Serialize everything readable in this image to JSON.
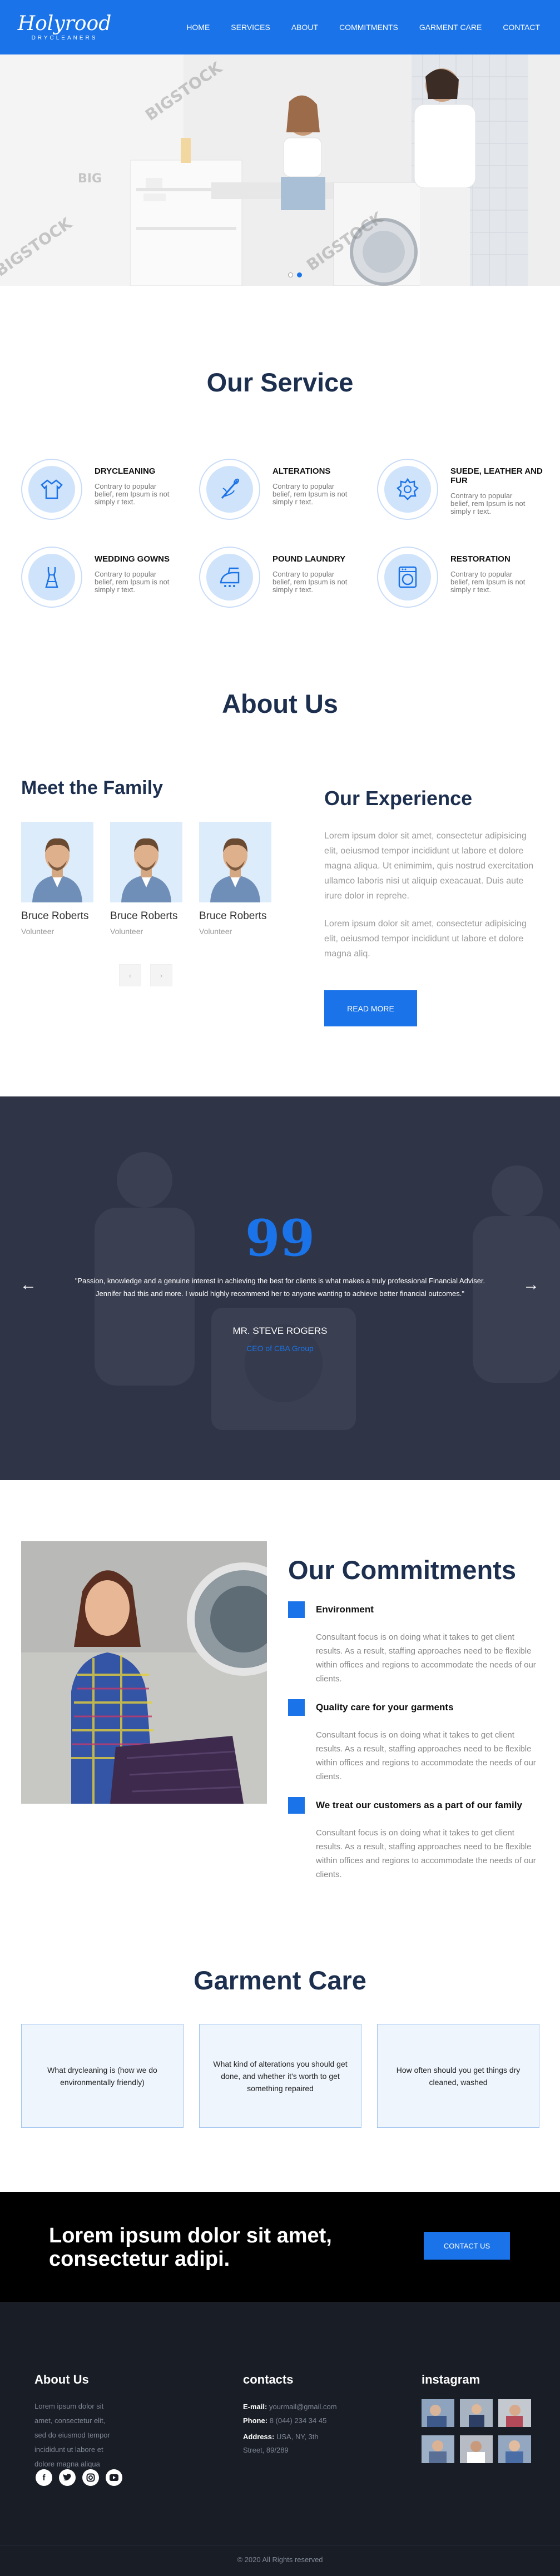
{
  "brand": {
    "logo_script": "Holyrood",
    "logo_sub": "DRYCLEANERS"
  },
  "nav": {
    "items": [
      "HOME",
      "SERVICES",
      "ABOUT",
      "COMMITMENTS",
      "GARMENT CARE",
      "CONTACT"
    ]
  },
  "hero": {
    "watermarks": [
      "BIGSTOCK",
      "BIG",
      "BIGSTOCK",
      "BIGSTOCK"
    ],
    "slide_count": 2,
    "active_slide": 1
  },
  "services": {
    "title": "Our Service",
    "items": [
      {
        "title": "DRYCLEANING",
        "desc": "Contrary to popular belief, rem Ipsum is not simply r text.",
        "icon": "shirt-icon"
      },
      {
        "title": "ALTERATIONS",
        "desc": "Contrary to popular belief, rem Ipsum is not simply r text.",
        "icon": "sewing-needle-icon"
      },
      {
        "title": "SUEDE, LEATHER AND FUR",
        "desc": "Contrary to popular belief, rem Ipsum is not simply r text.",
        "icon": "fabric-icon"
      },
      {
        "title": "WEDDING GOWNS",
        "desc": "Contrary to popular belief, rem Ipsum is not simply r text.",
        "icon": "gown-icon"
      },
      {
        "title": "POUND LAUNDRY",
        "desc": "Contrary to popular belief, rem Ipsum is not simply r text.",
        "icon": "iron-icon"
      },
      {
        "title": "RESTORATION",
        "desc": "Contrary to popular belief, rem Ipsum is not simply r text.",
        "icon": "washing-machine-icon"
      }
    ]
  },
  "about": {
    "title": "About Us",
    "family_title": "Meet the Family",
    "members": [
      {
        "name": "Bruce Roberts",
        "role": "Volunteer"
      },
      {
        "name": "Bruce Roberts",
        "role": "Volunteer"
      },
      {
        "name": "Bruce Roberts",
        "role": "Volunteer"
      }
    ],
    "prev_label": "‹",
    "next_label": "›",
    "experience_title": "Our Experience",
    "paragraph1": "Lorem ipsum dolor sit amet, consectetur adipisicing elit, oeiusmod tempor incididunt ut labore et dolore magna aliqua. Ut enimimim, quis nostrud exercitation ullamco laboris nisi ut aliquip exeacauat. Duis aute irure dolor in reprehe.",
    "paragraph2": "Lorem ipsum dolor sit amet, consectetur adipisicing elit, oeiusmod tempor incididunt ut labore et dolore magna aliq.",
    "read_more": "READ MORE"
  },
  "testimonial": {
    "quote_mark": "99",
    "quote": "\"Passion, knowledge and a genuine interest in achieving the best for clients is what makes a truly professional Financial Adviser. Jennifer had this and more. I would highly recommend her to anyone wanting to achieve better financial outcomes.\"",
    "name": "MR. STEVE ROGERS",
    "position": "CEO of CBA Group",
    "prev_arrow": "←",
    "next_arrow": "→"
  },
  "commitments": {
    "title": "Our Commitments",
    "items": [
      {
        "title": "Environment",
        "desc": "Consultant focus is on doing what it takes to get client results. As a result, staffing approaches need to be flexible within offices and regions to accommodate the needs of our clients."
      },
      {
        "title": "Quality care for your garments",
        "desc": "Consultant focus is on doing what it takes to get client results. As a result, staffing approaches need to be flexible within offices and regions to accommodate the needs of our clients."
      },
      {
        "title": "We treat our customers as a part of our family",
        "desc": "Consultant focus is on doing what it takes to get client results. As a result, staffing approaches need to be flexible within offices and regions to accommodate the needs of our clients."
      }
    ]
  },
  "garment_care": {
    "title": "Garment Care",
    "cards": [
      "What drycleaning is (how we do environmentally friendly)",
      "What kind of alterations you should get done, and whether it's worth to get something repaired",
      "How often should you get things dry cleaned, washed"
    ]
  },
  "cta": {
    "line1": "Lorem ipsum dolor sit amet,",
    "line2": "consectetur adipi.",
    "button": "CONTACT US"
  },
  "footer": {
    "about_title": "About Us",
    "about_text": "Lorem ipsum dolor sit amet, consectetur elit, sed do eiusmod tempor incididunt ut labore et dolore magna aliqua",
    "contacts_title": "contacts",
    "email_label": "E-mail:",
    "email": "yourmail@gmail.com",
    "phone_label": "Phone:",
    "phone": "8 (044) 234 34 45",
    "address_label": "Address:",
    "address": "USA, NY, 3th Street, 89/289",
    "instagram_title": "instagram",
    "social": [
      "facebook-icon",
      "twitter-icon",
      "instagram-icon",
      "youtube-icon"
    ],
    "copyright": "© 2020 All Rights reserved"
  },
  "colors": {
    "accent": "#1a73e8",
    "title": "#1d2f4f",
    "dark": "#2f3446",
    "footer": "#191d26"
  }
}
